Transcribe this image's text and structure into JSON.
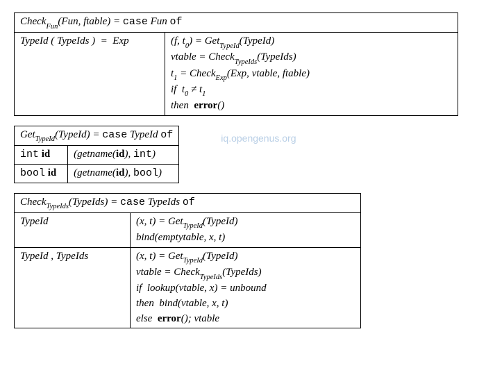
{
  "watermark": "iq.opengenus.org",
  "table1": {
    "header": "Check<sub>Fun</sub>(Fun, ftable) = <tt>case</tt> Fun <tt>of</tt>",
    "row": {
      "left": "TypeId ( TypeIds ) &nbsp;=&nbsp; Exp",
      "r1": "(f, t<sub>0</sub>) = Get<sub>TypeId</sub>(TypeId)",
      "r2": "vtable = Check<sub>TypeIds</sub>(TypeIds)",
      "r3": "t<sub>1</sub> = Check<sub>Exp</sub>(Exp, vtable, ftable)",
      "r4": "if&nbsp; t<sub>0</sub> ≠ t<sub>1</sub>",
      "r5": "then&nbsp; <b>error</b>()"
    }
  },
  "table2": {
    "header": "Get<sub>TypeId</sub>(TypeId) = <tt>case</tt> TypeId <tt>of</tt>",
    "row1_left": "<tt>int</tt> <b>id</b>",
    "row1_right": "(getname(<b>id</b>), <tt>int</tt>)",
    "row2_left": "<tt>bool</tt> <b>id</b>",
    "row2_right": "(getname(<b>id</b>), <tt>bool</tt>)"
  },
  "table3": {
    "header": "Check<sub>TypeIds</sub>(TypeIds) = <tt>case</tt> TypeIds <tt>of</tt>",
    "rowA": {
      "left": "TypeId",
      "r1": "(x, t) = Get<sub>TypeId</sub>(TypeId)",
      "r2": "bind(emptytable, x, t)"
    },
    "rowB": {
      "left": "TypeId , TypeIds",
      "r1": "(x, t) = Get<sub>TypeId</sub>(TypeId)",
      "r2": "vtable = Check<sub>TypeIds</sub>(TypeIds)",
      "r3": "if&nbsp; lookup(vtable, x) = unbound",
      "r4": "then&nbsp; bind(vtable, x, t)",
      "r5": "else&nbsp; <b>error</b>(); vtable"
    }
  }
}
